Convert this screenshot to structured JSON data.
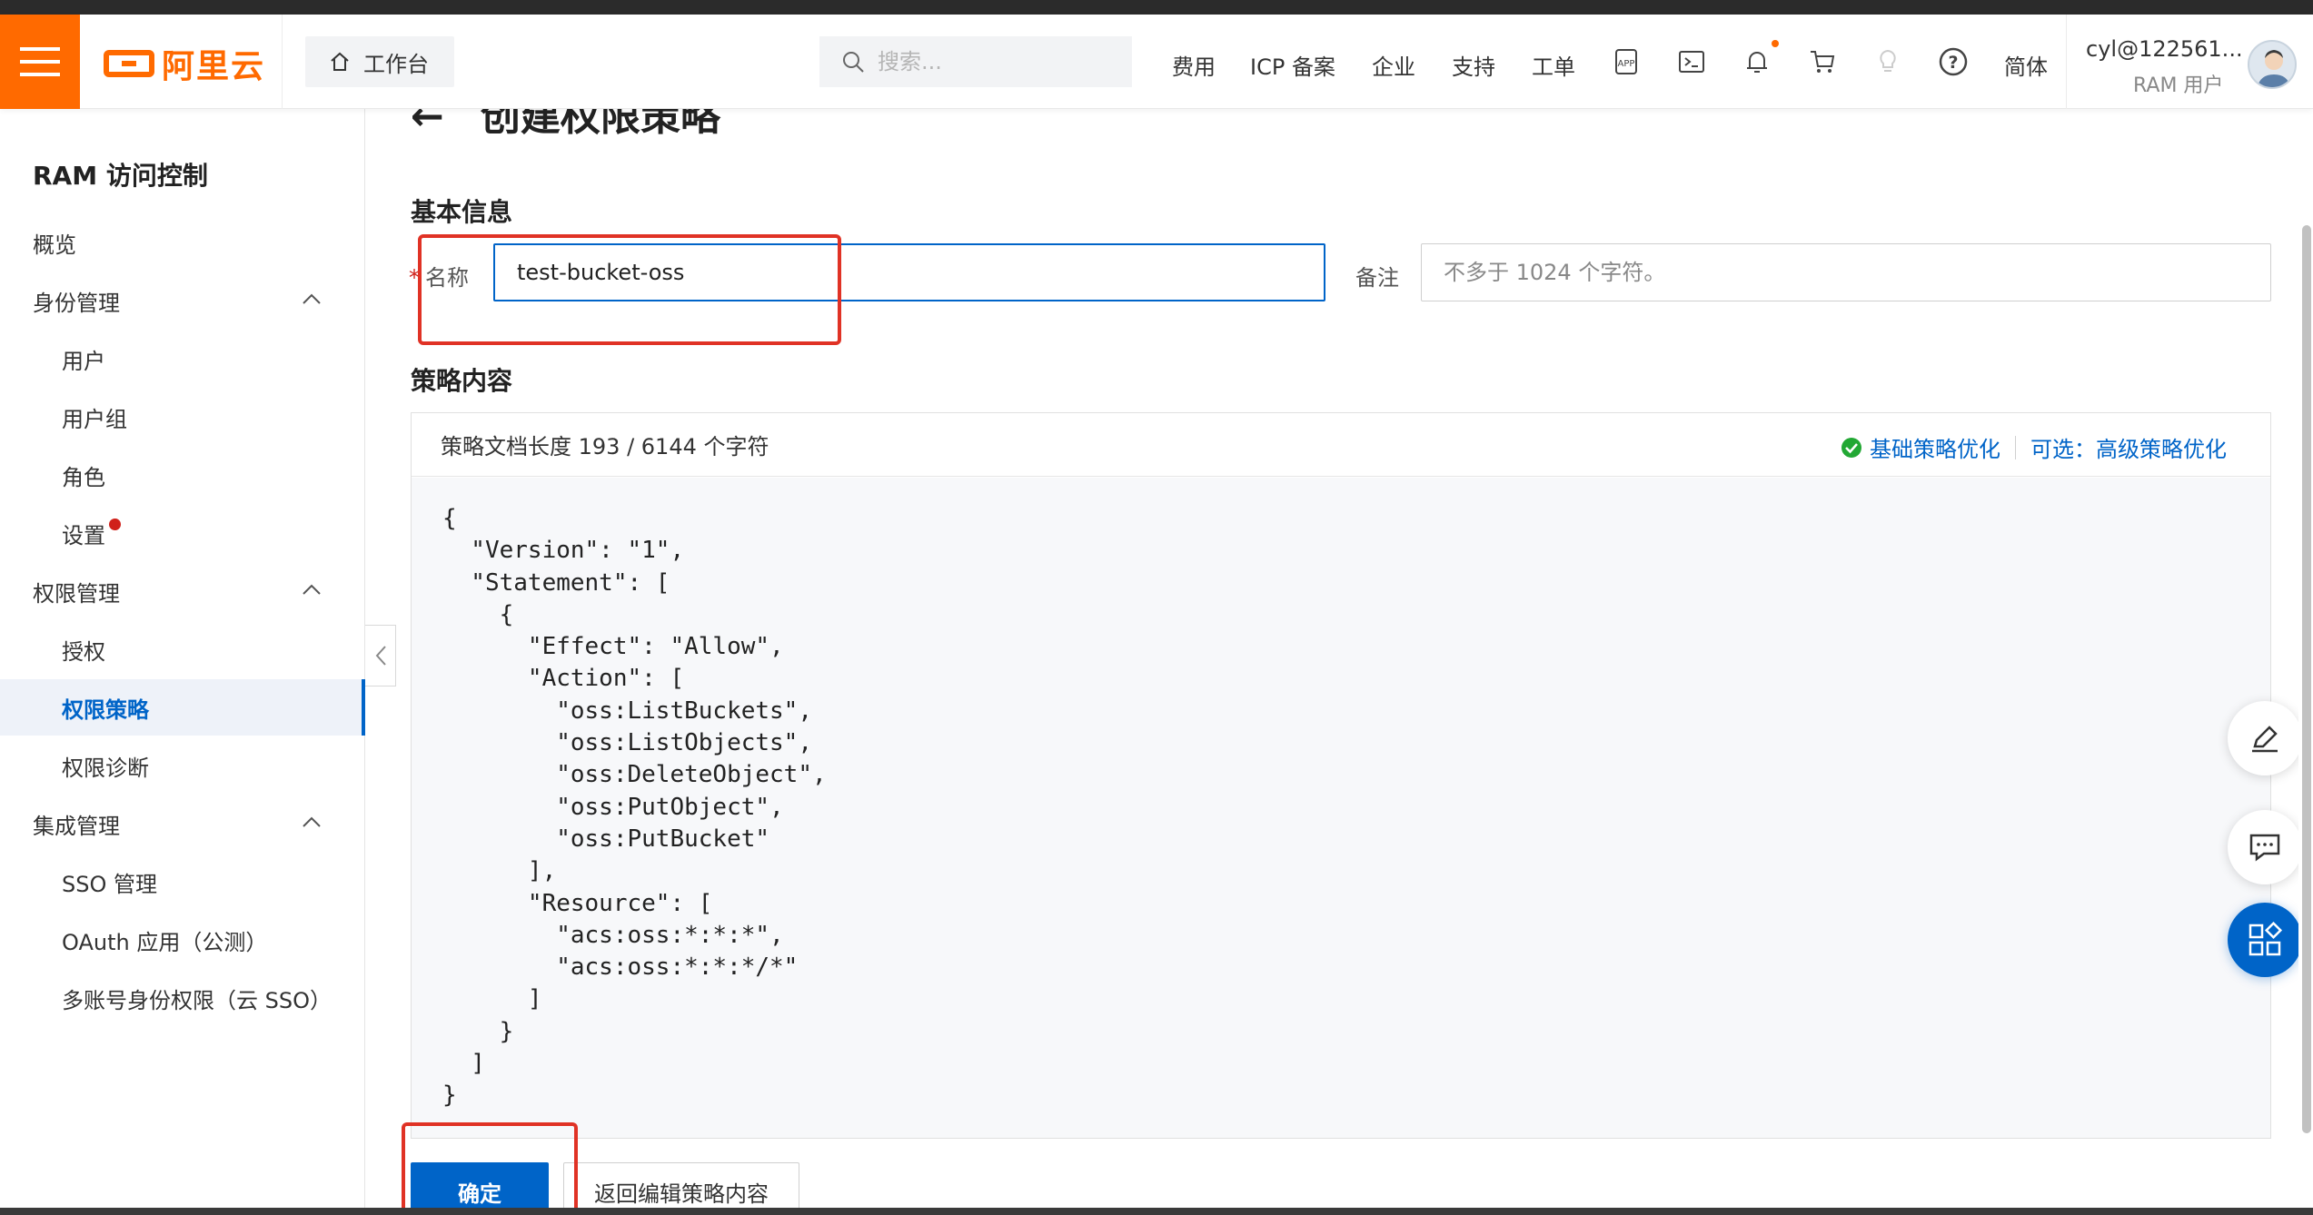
{
  "header": {
    "logo_text": "阿里云",
    "workbench_label": "工作台",
    "search_placeholder": "搜索...",
    "nav": [
      "费用",
      "ICP 备案",
      "企业",
      "支持",
      "工单"
    ],
    "lang_label": "简体",
    "user_name": "cyl@122561...",
    "user_role": "RAM 用户",
    "icons": [
      "app-icon",
      "terminal-icon",
      "bell-icon",
      "cart-icon",
      "lightbulb-icon",
      "help-icon"
    ],
    "accent_color": "#ff6a00"
  },
  "sidebar": {
    "title": "RAM 访问控制",
    "items": [
      {
        "label": "概览",
        "level": 1
      },
      {
        "label": "身份管理",
        "level": 1,
        "expanded": true
      },
      {
        "label": "用户",
        "level": 2
      },
      {
        "label": "用户组",
        "level": 2
      },
      {
        "label": "角色",
        "level": 2
      },
      {
        "label": "设置",
        "level": 2,
        "dot": true
      },
      {
        "label": "权限管理",
        "level": 1,
        "expanded": true
      },
      {
        "label": "授权",
        "level": 2
      },
      {
        "label": "权限策略",
        "level": 2,
        "active": true
      },
      {
        "label": "权限诊断",
        "level": 2
      },
      {
        "label": "集成管理",
        "level": 1,
        "expanded": true
      },
      {
        "label": "SSO 管理",
        "level": 2
      },
      {
        "label": "OAuth 应用（公测）",
        "level": 2
      },
      {
        "label": "多账号身份权限（云 SSO）",
        "level": 2
      }
    ]
  },
  "main": {
    "page_title": "创建权限策略",
    "basic_info_title": "基本信息",
    "name_label": "名称",
    "name_value": "test-bucket-oss",
    "remark_label": "备注",
    "remark_placeholder": "不多于 1024 个字符。",
    "policy_title": "策略内容",
    "doc_length_text": "策略文档长度 193 / 6144 个字符",
    "basic_optimize_label": "基础策略优化",
    "advanced_optimize_label": "可选：高级策略优化",
    "policy_code": "{\n  \"Version\": \"1\",\n  \"Statement\": [\n    {\n      \"Effect\": \"Allow\",\n      \"Action\": [\n        \"oss:ListBuckets\",\n        \"oss:ListObjects\",\n        \"oss:DeleteObject\",\n        \"oss:PutObject\",\n        \"oss:PutBucket\"\n      ],\n      \"Resource\": [\n        \"acs:oss:*:*:*\",\n        \"acs:oss:*:*:*/*\"\n      ]\n    }\n  ]\n}",
    "confirm_label": "确定",
    "back_edit_label": "返回编辑策略内容"
  },
  "colors": {
    "primary": "#0064c8",
    "success": "#22a834",
    "annotation_red": "#e03225"
  }
}
